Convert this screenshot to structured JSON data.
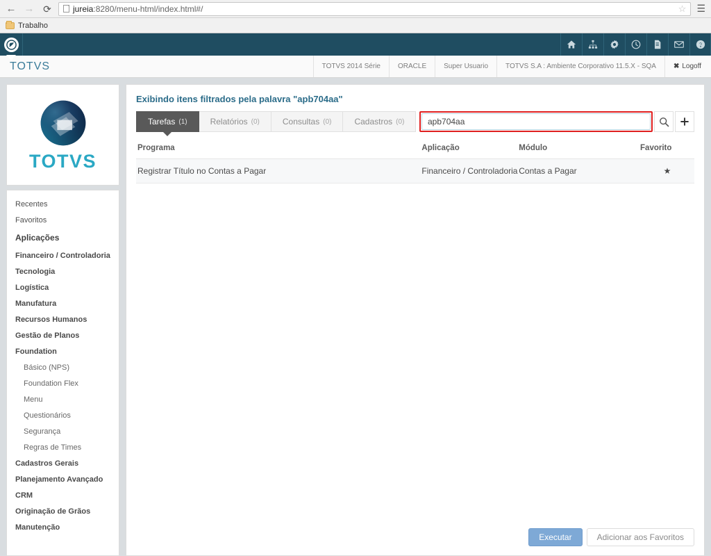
{
  "browser": {
    "back_icon": "arrow-left-icon",
    "forward_icon": "arrow-right-icon",
    "reload_icon": "reload-icon",
    "url_host": "jureia",
    "url_rest": ":8280/menu-html/index.html#/",
    "star_icon": "star-outline-icon",
    "menu_icon": "hamburger-menu-icon",
    "bookmarks": [
      {
        "label": "Trabalho",
        "icon": "folder-icon"
      }
    ]
  },
  "toolbar": {
    "logo_icon": "totvs-badge-icon",
    "icons": [
      {
        "name": "home-icon"
      },
      {
        "name": "sitemap-icon"
      },
      {
        "name": "gear-icon"
      },
      {
        "name": "clock-icon"
      },
      {
        "name": "document-icon"
      },
      {
        "name": "envelope-icon"
      },
      {
        "name": "help-circle-icon"
      }
    ]
  },
  "subheader": {
    "brand": "TOTVS",
    "items": [
      "TOTVS 2014 Série",
      "ORACLE",
      "Super Usuario",
      "TOTVS S.A : Ambiente Corporativo 11.5.X - SQA"
    ],
    "logoff_label": "Logoff",
    "logoff_icon": "close-x-icon"
  },
  "sidebar": {
    "logo_word": "TOTVS",
    "logo_icon": "totvs-sphere-icon",
    "items": [
      {
        "label": "Recentes",
        "level": "plain"
      },
      {
        "label": "Favoritos",
        "level": "plain"
      },
      {
        "label": "Aplicações",
        "level": "section"
      },
      {
        "label": "Financeiro / Controladoria",
        "level": "item"
      },
      {
        "label": "Tecnologia",
        "level": "item"
      },
      {
        "label": "Logística",
        "level": "item"
      },
      {
        "label": "Manufatura",
        "level": "item"
      },
      {
        "label": "Recursos Humanos",
        "level": "item"
      },
      {
        "label": "Gestão de Planos",
        "level": "item"
      },
      {
        "label": "Foundation",
        "level": "item"
      },
      {
        "label": "Básico (NPS)",
        "level": "sub"
      },
      {
        "label": "Foundation Flex",
        "level": "sub"
      },
      {
        "label": "Menu",
        "level": "sub"
      },
      {
        "label": "Questionários",
        "level": "sub"
      },
      {
        "label": "Segurança",
        "level": "sub"
      },
      {
        "label": "Regras de Times",
        "level": "sub"
      },
      {
        "label": "Cadastros Gerais",
        "level": "item"
      },
      {
        "label": "Planejamento Avançado",
        "level": "item"
      },
      {
        "label": "CRM",
        "level": "item"
      },
      {
        "label": "Originação de Grãos",
        "level": "item"
      },
      {
        "label": "Manutenção",
        "level": "item"
      }
    ]
  },
  "main": {
    "title": "Exibindo itens filtrados pela palavra \"apb704aa\"",
    "tabs": [
      {
        "label": "Tarefas",
        "count": "(1)",
        "active": true
      },
      {
        "label": "Relatórios",
        "count": "(0)",
        "active": false
      },
      {
        "label": "Consultas",
        "count": "(0)",
        "active": false
      },
      {
        "label": "Cadastros",
        "count": "(0)",
        "active": false
      }
    ],
    "search": {
      "value": "apb704aa",
      "placeholder": "",
      "search_icon": "magnifier-icon",
      "add_icon": "plus-icon",
      "highlight_color": "#e02020"
    },
    "table": {
      "headers": [
        "Programa",
        "Aplicação",
        "Módulo",
        "Favorito"
      ],
      "rows": [
        {
          "programa": "Registrar Título no Contas a Pagar",
          "aplicacao": "Financeiro / Controladoria",
          "modulo": "Contas a Pagar",
          "favorito": "★"
        }
      ]
    },
    "footer": {
      "execute_label": "Executar",
      "favorite_label": "Adicionar aos Favoritos"
    }
  },
  "colors": {
    "toolbar_bg": "#1f4d61",
    "brand": "#2aa8c4",
    "title": "#2b6c89",
    "primary_btn": "#7ea9d6",
    "active_tab": "#595959"
  }
}
